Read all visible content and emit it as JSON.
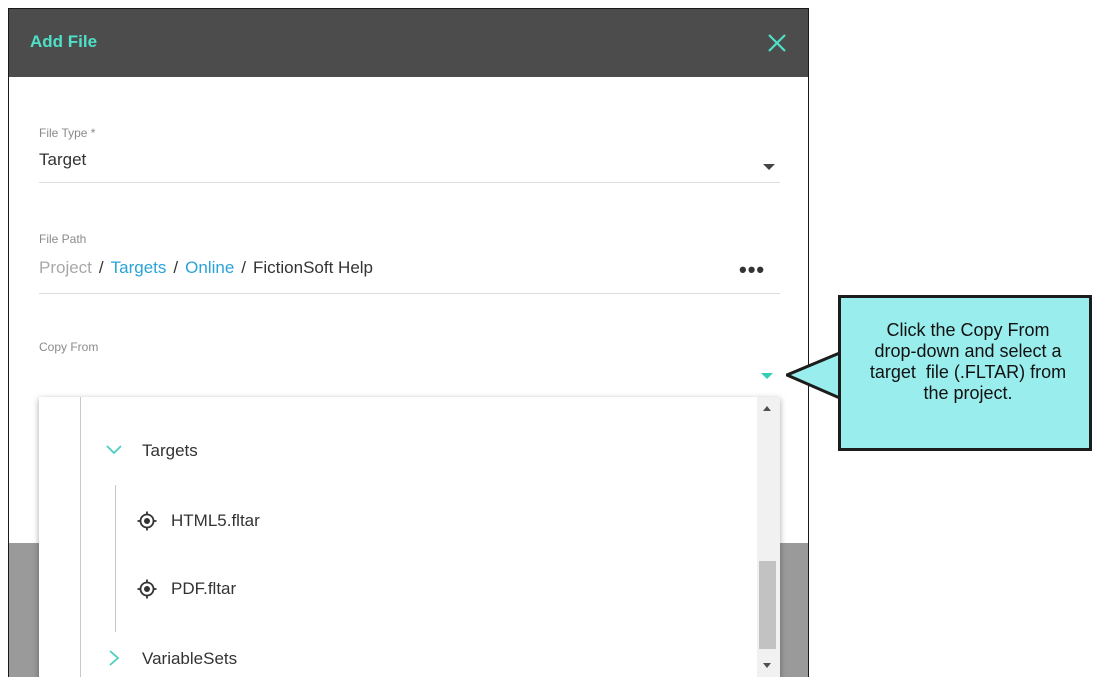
{
  "dialog": {
    "title": "Add File",
    "close_icon": "close-icon",
    "file_type": {
      "label": "File Type *",
      "value": "Target"
    },
    "file_path": {
      "label": "File Path",
      "crumbs": [
        "Project",
        "Targets",
        "Online",
        "FictionSoft Help"
      ],
      "separator": "/",
      "more_label": "•••"
    },
    "copy_from": {
      "label": "Copy From",
      "value": ""
    },
    "tree": {
      "folder_expanded": "Targets",
      "files": [
        "HTML5.fltar",
        "PDF.fltar"
      ],
      "folder_collapsed": "VariableSets"
    }
  },
  "callout": {
    "lines": [
      "Click the Copy From",
      "drop-down and select a",
      "target  file (.FLTAR) from",
      "the project."
    ]
  },
  "colors": {
    "header_bg": "#4c4c4c",
    "accent_teal": "#4ee0c8",
    "link_blue": "#2aa3d8",
    "callout_bg": "#99eded"
  }
}
